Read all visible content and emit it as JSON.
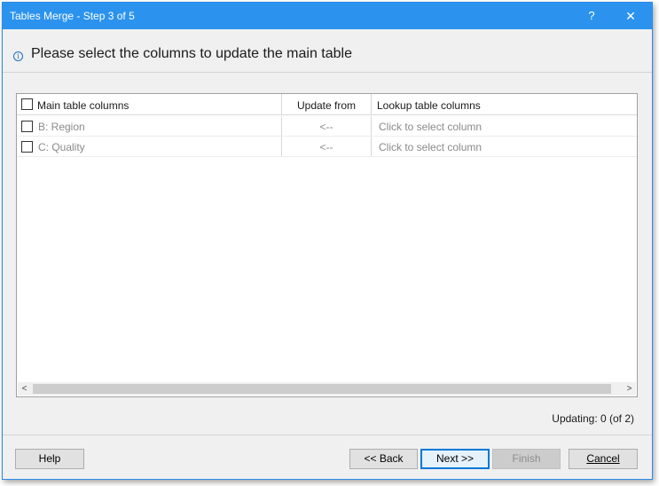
{
  "window": {
    "title": "Tables Merge - Step 3 of 5",
    "help_glyph": "?",
    "close_glyph": "✕"
  },
  "header": {
    "info_glyph": "i",
    "text": "Please select the columns to update the main table"
  },
  "grid": {
    "columns": [
      "Main table columns",
      "Update from",
      "Lookup table columns"
    ],
    "rows": [
      {
        "main": "B: Region",
        "update": "<--",
        "lookup": "Click to select column",
        "checked": false
      },
      {
        "main": "C: Quality",
        "update": "<--",
        "lookup": "Click to select column",
        "checked": false
      }
    ],
    "scroll_left_glyph": "<",
    "scroll_right_glyph": ">"
  },
  "status": {
    "updating": "Updating: 0 (of 2)"
  },
  "buttons": {
    "help": "Help",
    "back": "<< Back",
    "next": "Next >>",
    "finish": "Finish",
    "cancel": "Cancel"
  }
}
